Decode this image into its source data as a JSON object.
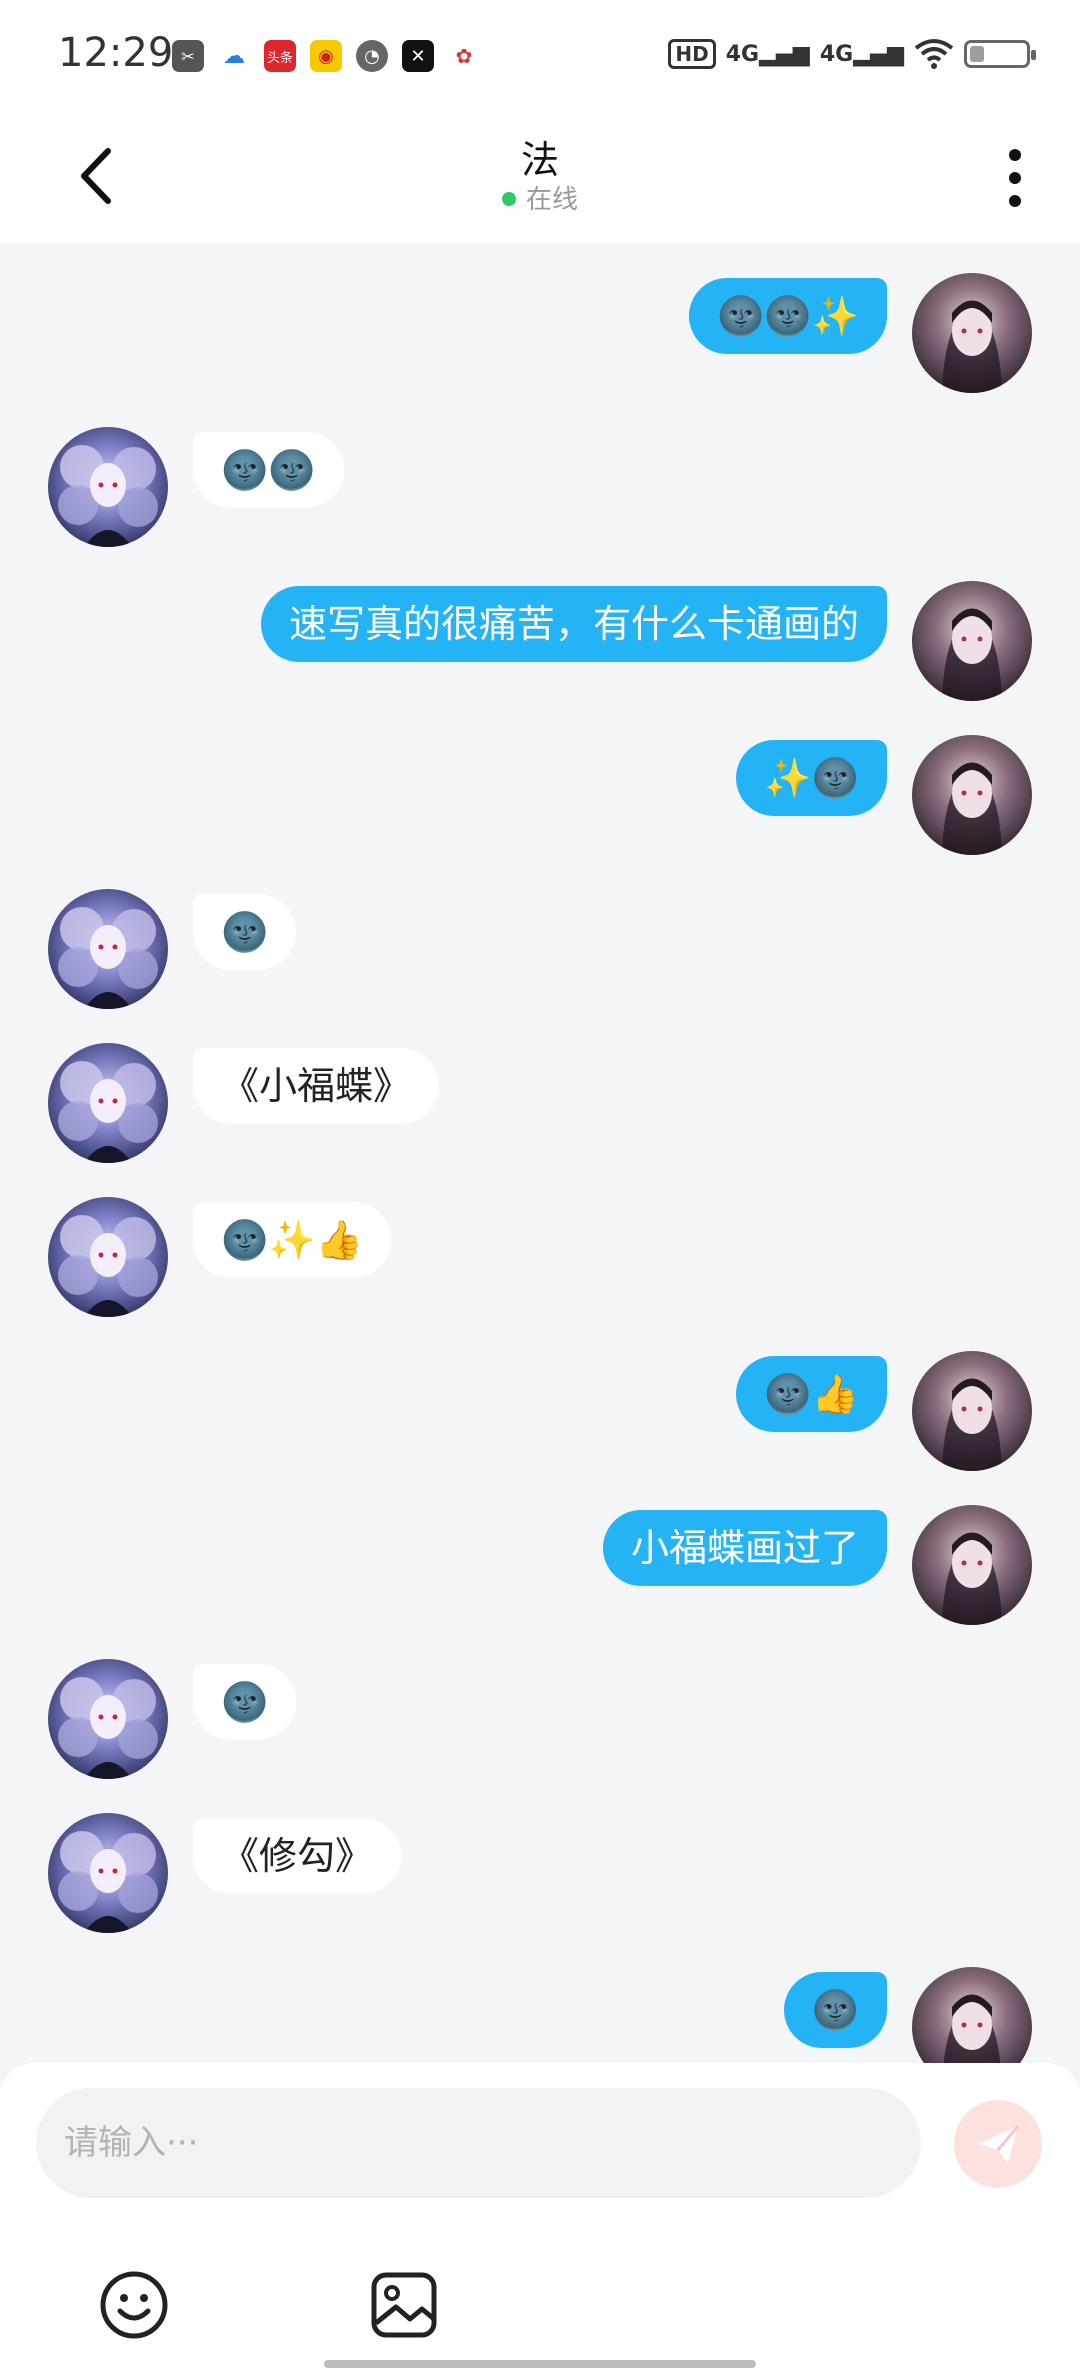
{
  "status_bar": {
    "time": "12:29",
    "network1": "4G",
    "network2": "4G",
    "hd": "HD",
    "battery_level": 0.25,
    "app_icons": [
      "scissors-app-icon",
      "cloud-app-icon",
      "toutiao-app-icon",
      "weibo-app-icon",
      "speedometer-app-icon",
      "capcut-app-icon",
      "colorful-app-icon"
    ],
    "toutiao_label": "头条"
  },
  "header": {
    "title": "法",
    "status": "在线",
    "status_color": "#2ec866"
  },
  "messages": [
    {
      "side": "right",
      "text": "🌚🌚✨"
    },
    {
      "side": "left",
      "text": "🌚🌚"
    },
    {
      "side": "right",
      "text": "速写真的很痛苦，有什么卡通画的"
    },
    {
      "side": "right",
      "text": "✨🌚"
    },
    {
      "side": "left",
      "text": "🌚"
    },
    {
      "side": "left",
      "text": "《小福蝶》"
    },
    {
      "side": "left",
      "text": "🌚✨👍"
    },
    {
      "side": "right",
      "text": "🌚👍"
    },
    {
      "side": "right",
      "text": "小福蝶画过了"
    },
    {
      "side": "left",
      "text": "🌚"
    },
    {
      "side": "left",
      "text": "《修勾》"
    },
    {
      "side": "right",
      "text": "🌚"
    }
  ],
  "composer": {
    "placeholder": "请输入···",
    "send_icon": "paper-plane-icon",
    "emoji_icon": "smiley-face-icon",
    "image_icon": "image-icon"
  },
  "colors": {
    "my_bubble": "#24b4f6",
    "their_bubble": "#ffffff",
    "background": "#f4f5f7"
  }
}
